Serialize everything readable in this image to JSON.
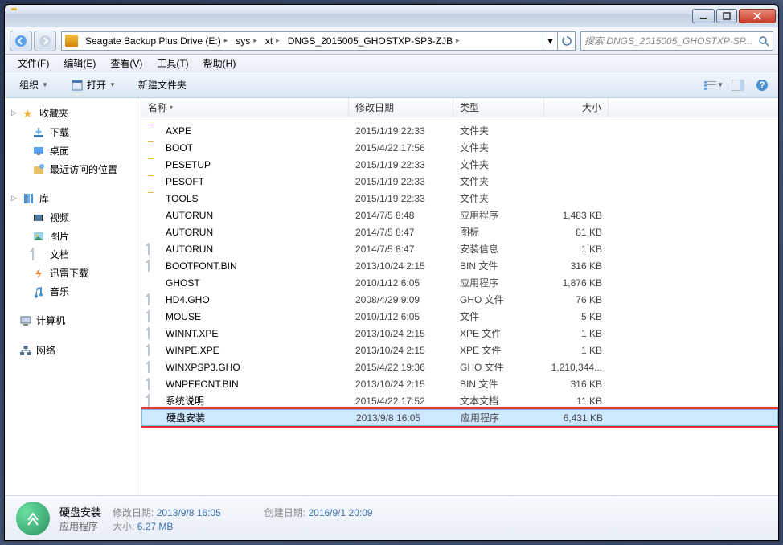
{
  "nav": {
    "crumbs": [
      "Seagate Backup Plus Drive (E:)",
      "sys",
      "xt",
      "DNGS_2015005_GHOSTXP-SP3-ZJB"
    ],
    "search_placeholder": "搜索 DNGS_2015005_GHOSTXP-SP..."
  },
  "menus": [
    "文件(F)",
    "编辑(E)",
    "查看(V)",
    "工具(T)",
    "帮助(H)"
  ],
  "toolbar": {
    "organize": "组织",
    "open": "打开",
    "newfolder": "新建文件夹"
  },
  "sidebar": {
    "favorites": {
      "label": "收藏夹",
      "items": [
        "下载",
        "桌面",
        "最近访问的位置"
      ]
    },
    "libraries": {
      "label": "库",
      "items": [
        "视频",
        "图片",
        "文档",
        "迅雷下载",
        "音乐"
      ]
    },
    "computer": {
      "label": "计算机"
    },
    "network": {
      "label": "网络"
    }
  },
  "columns": {
    "name": "名称",
    "date": "修改日期",
    "type": "类型",
    "size": "大小"
  },
  "files": [
    {
      "icon": "folder",
      "name": "AXPE",
      "date": "2015/1/19 22:33",
      "type": "文件夹",
      "size": ""
    },
    {
      "icon": "folder",
      "name": "BOOT",
      "date": "2015/4/22 17:56",
      "type": "文件夹",
      "size": ""
    },
    {
      "icon": "folder",
      "name": "PESETUP",
      "date": "2015/1/19 22:33",
      "type": "文件夹",
      "size": ""
    },
    {
      "icon": "folder",
      "name": "PESOFT",
      "date": "2015/1/19 22:33",
      "type": "文件夹",
      "size": ""
    },
    {
      "icon": "folder",
      "name": "TOOLS",
      "date": "2015/1/19 22:33",
      "type": "文件夹",
      "size": ""
    },
    {
      "icon": "exe",
      "name": "AUTORUN",
      "date": "2014/7/5 8:48",
      "type": "应用程序",
      "size": "1,483 KB"
    },
    {
      "icon": "ico",
      "name": "AUTORUN",
      "date": "2014/7/5 8:47",
      "type": "图标",
      "size": "81 KB"
    },
    {
      "icon": "file",
      "name": "AUTORUN",
      "date": "2014/7/5 8:47",
      "type": "安装信息",
      "size": "1 KB"
    },
    {
      "icon": "file",
      "name": "BOOTFONT.BIN",
      "date": "2013/10/24 2:15",
      "type": "BIN 文件",
      "size": "316 KB"
    },
    {
      "icon": "exe",
      "name": "GHOST",
      "date": "2010/1/12 6:05",
      "type": "应用程序",
      "size": "1,876 KB"
    },
    {
      "icon": "file",
      "name": "HD4.GHO",
      "date": "2008/4/29 9:09",
      "type": "GHO 文件",
      "size": "76 KB"
    },
    {
      "icon": "file",
      "name": "MOUSE",
      "date": "2010/1/12 6:05",
      "type": "文件",
      "size": "5 KB"
    },
    {
      "icon": "file",
      "name": "WINNT.XPE",
      "date": "2013/10/24 2:15",
      "type": "XPE 文件",
      "size": "1 KB"
    },
    {
      "icon": "file",
      "name": "WINPE.XPE",
      "date": "2013/10/24 2:15",
      "type": "XPE 文件",
      "size": "1 KB"
    },
    {
      "icon": "file",
      "name": "WINXPSP3.GHO",
      "date": "2015/4/22 19:36",
      "type": "GHO 文件",
      "size": "1,210,344..."
    },
    {
      "icon": "file",
      "name": "WNPEFONT.BIN",
      "date": "2013/10/24 2:15",
      "type": "BIN 文件",
      "size": "316 KB"
    },
    {
      "icon": "file",
      "name": "系统说明",
      "date": "2015/4/22 17:52",
      "type": "文本文档",
      "size": "11 KB"
    },
    {
      "icon": "green",
      "name": "硬盘安装",
      "date": "2013/9/8 16:05",
      "type": "应用程序",
      "size": "6,431 KB",
      "selected": true,
      "highlighted": true
    }
  ],
  "details": {
    "name": "硬盘安装",
    "type": "应用程序",
    "mod_label": "修改日期:",
    "mod": "2013/9/8 16:05",
    "size_label": "大小:",
    "size": "6.27 MB",
    "created_label": "创建日期:",
    "created": "2016/9/1 20:09"
  }
}
